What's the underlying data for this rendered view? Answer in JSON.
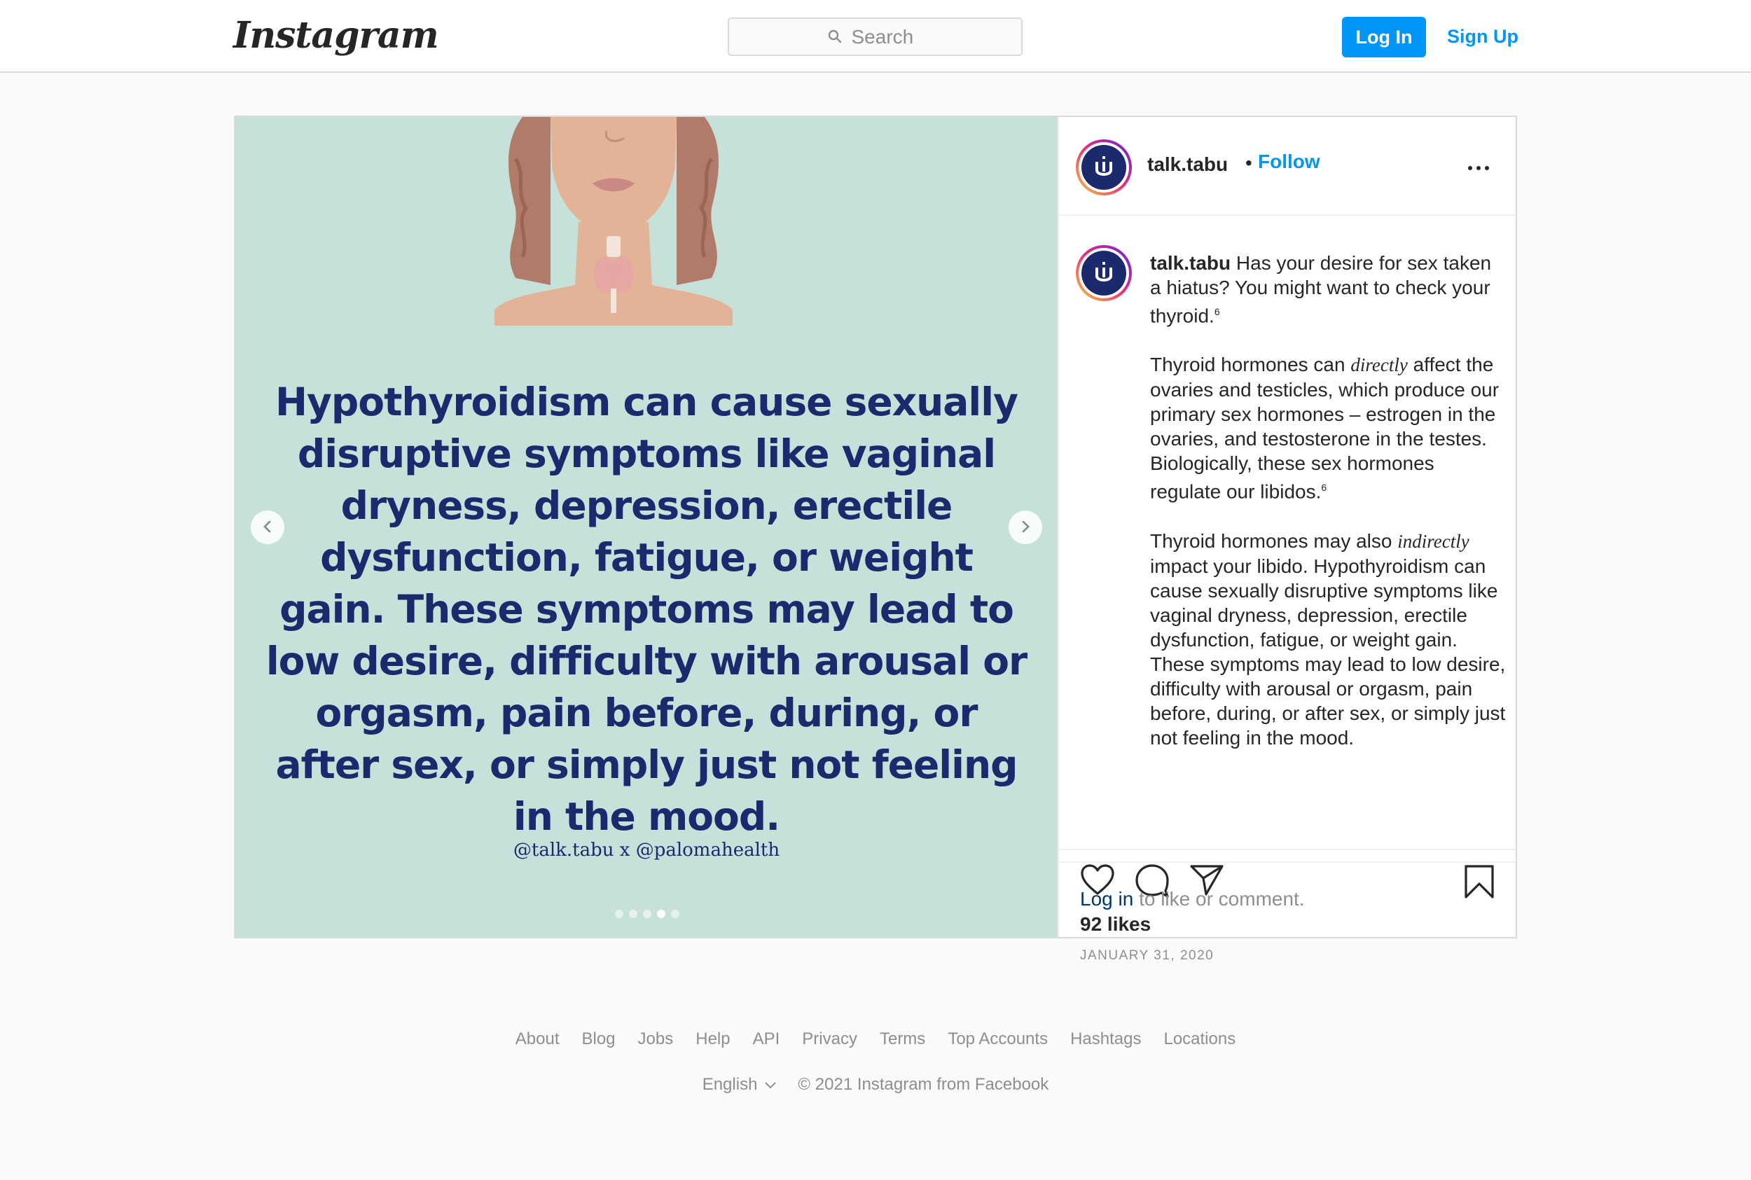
{
  "header": {
    "logo": "Instagram",
    "search_placeholder": "Search",
    "login_label": "Log In",
    "signup_label": "Sign Up"
  },
  "post": {
    "username": "talk.tabu",
    "separator": "•",
    "follow_label": "Follow",
    "image_text": "Hypothyroidism can cause sexually disruptive symptoms like vaginal dryness, depression, erectile dysfunction, fatigue, or weight gain. These symptoms may lead to low desire, difficulty with arousal or orgasm, pain before, during, or after sex, or simply just not feeling in the mood.",
    "image_credit": "@talk.tabu x @palomahealth",
    "carousel": {
      "total": 5,
      "active_index": 3
    },
    "caption": {
      "username": "talk.tabu",
      "p1": "Has your desire for sex taken a hiatus? You might want to check your thyroid.",
      "p1_ref": "6",
      "p2_pre": "Thyroid hormones can",
      "p2_em": "directly",
      "p2_post": "affect the ovaries and testicles, which produce our primary sex hormones – estrogen in the ovaries, and testosterone in the testes. Biologically, these sex hormones regulate our libidos.",
      "p2_ref": "6",
      "p3_pre": "Thyroid hormones may also",
      "p3_em": "indirectly",
      "p3_post": "impact your libido. Hypothyroidism can cause sexually disruptive symptoms like vaginal dryness, depression, erectile dysfunction, fatigue, or weight gain. These symptoms may lead to low desire, difficulty with arousal or orgasm, pain before, during, or after sex, or simply just not feeling in the mood."
    },
    "likes": "92 likes",
    "date": "JANUARY 31, 2020",
    "login_link": "Log in",
    "login_suffix": "to like or comment."
  },
  "icons": {
    "like": "heart-icon",
    "comment": "comment-icon",
    "share": "paper-plane-icon",
    "save": "bookmark-icon",
    "search": "search-icon",
    "more": "more-options-icon"
  },
  "footer": {
    "links": [
      "About",
      "Blog",
      "Jobs",
      "Help",
      "API",
      "Privacy",
      "Terms",
      "Top Accounts",
      "Hashtags",
      "Locations"
    ],
    "language": "English",
    "copyright": "© 2021 Instagram from Facebook"
  },
  "colors": {
    "accent": "#0095f6",
    "image_bg": "#c6e0da",
    "image_text": "#1a2a6c",
    "link_dark": "#00376b"
  }
}
